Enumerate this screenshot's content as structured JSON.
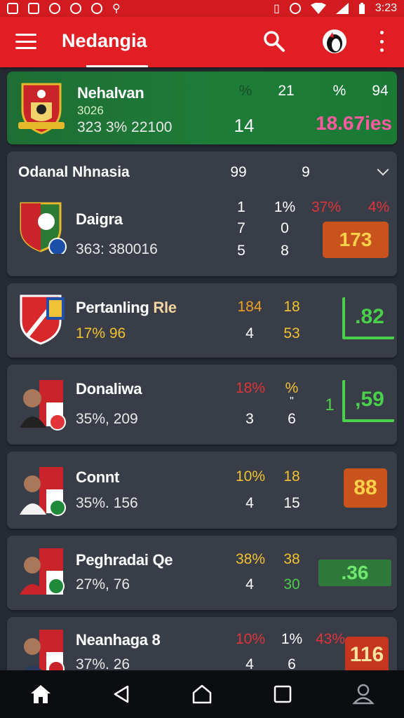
{
  "status_bar": {
    "time": "3:23"
  },
  "app_bar": {
    "title": "Nedangia"
  },
  "featured": {
    "team": "Nehalvan",
    "line1": "3026",
    "line2": "323 3% 22100",
    "c1": "%",
    "c2": "21",
    "c3": "%",
    "c4": "94",
    "mid": "14",
    "big": "18.67ies"
  },
  "group": {
    "title": "Odanal Nhnasia",
    "h1": "99",
    "h2": "9",
    "team": "Daigra",
    "sub": "363: 380016",
    "r1": [
      "1",
      "1%",
      "37%",
      "4%"
    ],
    "r2": [
      "7",
      "0"
    ],
    "r3": [
      "5",
      "8"
    ],
    "badge": "173"
  },
  "rows": [
    {
      "team": "Pertanling",
      "team_suffix": "Rle",
      "sub": "17% 96",
      "top1": "184",
      "top2": "18",
      "bot1": "4",
      "bot2": "53",
      "value": ".82"
    },
    {
      "team": "Donaliwa",
      "sub": "35%, 209",
      "top1": "18%",
      "top2": "%",
      "mid2": "\"",
      "bot1": "3",
      "bot2": "6",
      "extra": "1",
      "value": ",59"
    },
    {
      "team": "Connt",
      "sub": "35%. 156",
      "top1": "10%",
      "top2": "18",
      "bot1": "4",
      "bot2": "15",
      "value": "88"
    },
    {
      "team": "Peghradai Qe",
      "sub": "27%, 76",
      "top1": "38%",
      "top2": "38",
      "bot1": "4",
      "bot2": "30",
      "value": ".36"
    },
    {
      "team": "Neanhaga 8",
      "sub": "37%. 26",
      "top1": "10%",
      "top2": "1%",
      "top3": "43%",
      "bot1": "4",
      "bot2": "6",
      "value": "116"
    }
  ]
}
